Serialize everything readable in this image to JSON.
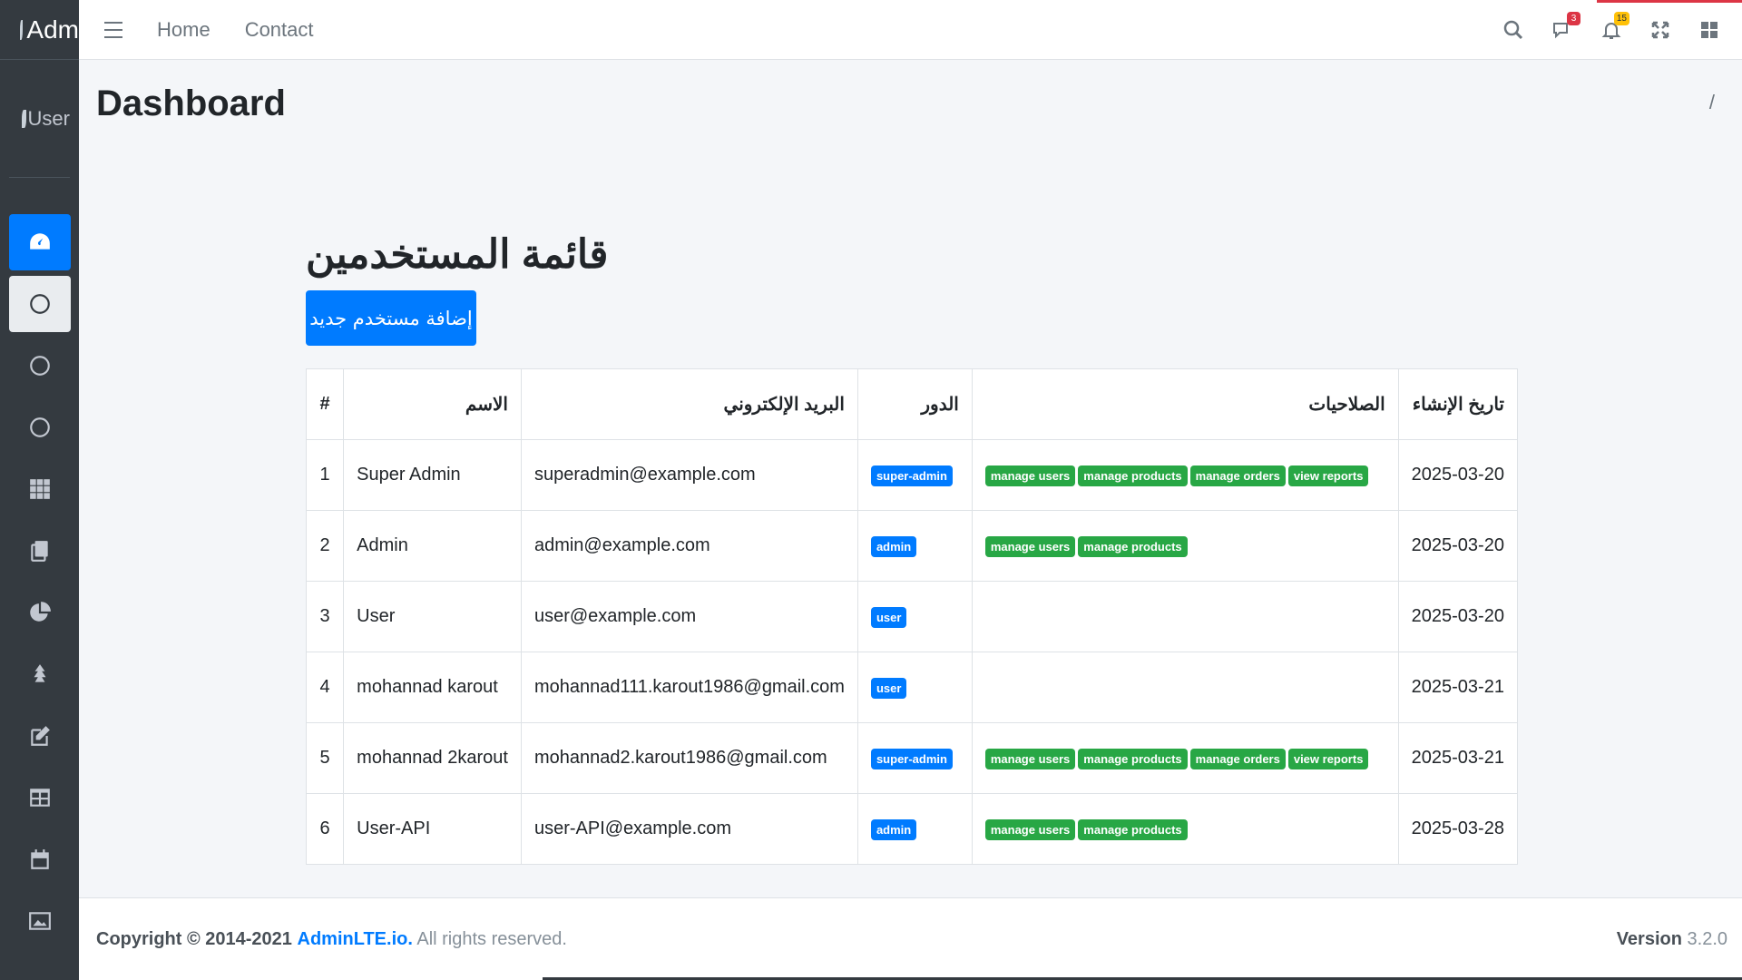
{
  "brand": {
    "text": "Adm"
  },
  "user_panel": {
    "text": "User"
  },
  "navbar": {
    "links": [
      "Home",
      "Contact"
    ],
    "messages_badge": "3",
    "notifications_badge": "15"
  },
  "header": {
    "title": "Dashboard",
    "breadcrumb": "/"
  },
  "main": {
    "title": "قائمة المستخدمين",
    "add_button": "إضافة مستخدم جديد"
  },
  "table": {
    "headers": [
      "#",
      "الاسم",
      "البريد الإلكتروني",
      "الدور",
      "الصلاحيات",
      "تاريخ الإنشاء"
    ],
    "rows": [
      {
        "idx": "1",
        "name": "Super Admin",
        "email": "superadmin@example.com",
        "role": "super-admin",
        "perms": [
          "manage users",
          "manage products",
          "manage orders",
          "view reports"
        ],
        "date": "2025-03-20"
      },
      {
        "idx": "2",
        "name": "Admin",
        "email": "admin@example.com",
        "role": "admin",
        "perms": [
          "manage users",
          "manage products"
        ],
        "date": "2025-03-20"
      },
      {
        "idx": "3",
        "name": "User",
        "email": "user@example.com",
        "role": "user",
        "perms": [],
        "date": "2025-03-20"
      },
      {
        "idx": "4",
        "name": "mohannad karout",
        "email": "mohannad111.karout1986@gmail.com",
        "role": "user",
        "perms": [],
        "date": "2025-03-21"
      },
      {
        "idx": "5",
        "name": "mohannad 2karout",
        "email": "mohannad2.karout1986@gmail.com",
        "role": "super-admin",
        "perms": [
          "manage users",
          "manage products",
          "manage orders",
          "view reports"
        ],
        "date": "2025-03-21"
      },
      {
        "idx": "6",
        "name": "User-API",
        "email": "user-API@example.com",
        "role": "admin",
        "perms": [
          "manage users",
          "manage products"
        ],
        "date": "2025-03-28"
      }
    ]
  },
  "footer": {
    "copyright": "Copyright © 2014-2021",
    "link": "AdminLTE.io.",
    "rights": "All rights reserved.",
    "version_label": "Version",
    "version": "3.2.0"
  },
  "colors": {
    "primary": "#007bff",
    "success": "#28a745",
    "sidebar": "#343a40",
    "danger": "#dc3545",
    "warning": "#ffc107"
  }
}
